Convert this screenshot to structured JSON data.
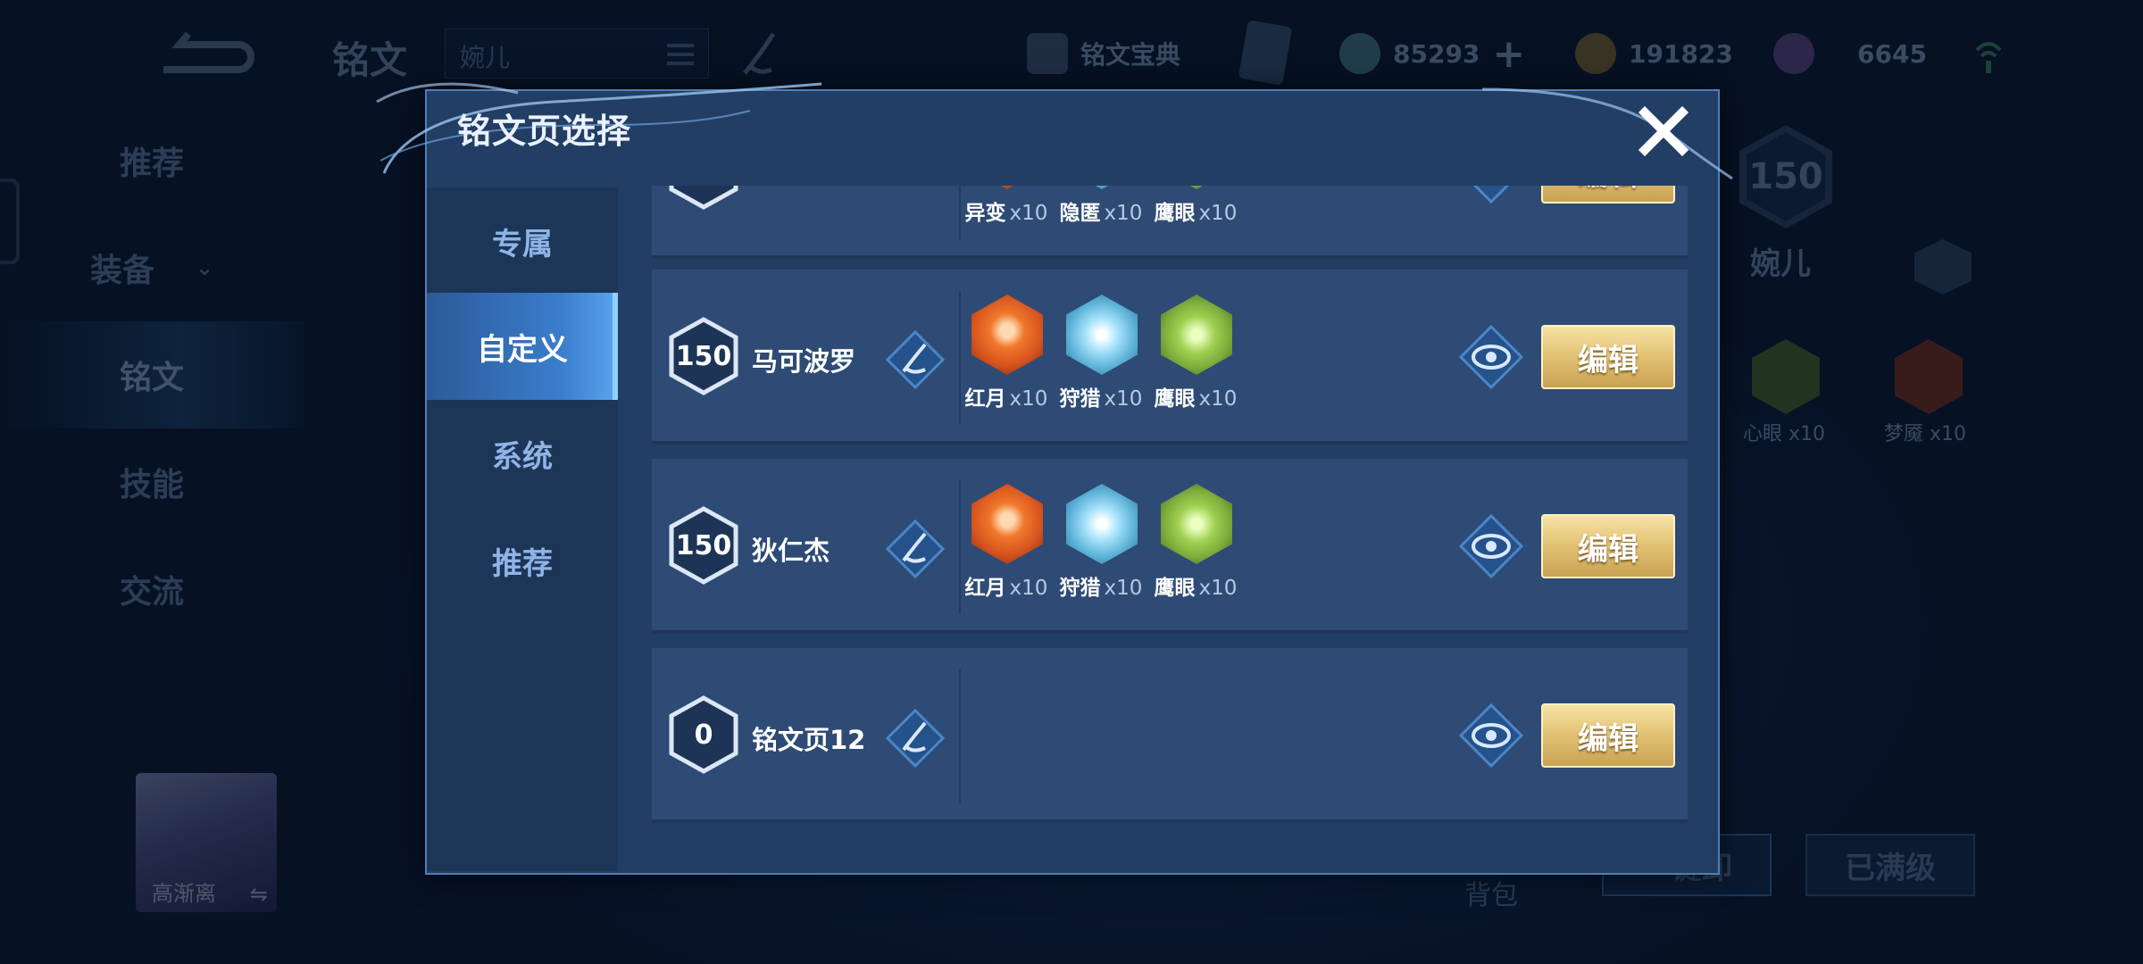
{
  "page": {
    "title": "铭文",
    "hero_search_value": "婉儿",
    "codex_label": "铭文宝典",
    "currencies": {
      "coupons": "85293",
      "gold": "191823",
      "crystal": "6645"
    },
    "nav": [
      "推荐",
      "装备",
      "铭文",
      "技能",
      "交流"
    ],
    "hero_name": "高渐离",
    "right_hero_name": "婉儿",
    "right_level": "150",
    "right_runes": [
      "心眼 x10",
      "梦魇 x10"
    ],
    "bag_label": "背包",
    "unload_label": "一键卸",
    "maxed_label": "已满级"
  },
  "modal": {
    "title": "铭文页选择",
    "tabs": [
      {
        "label": "专属"
      },
      {
        "label": "自定义"
      },
      {
        "label": "系统"
      },
      {
        "label": "推荐"
      }
    ],
    "active_tab": "自定义",
    "pages": [
      {
        "level": "",
        "name": "",
        "runes": [
          {
            "name": "异变",
            "count": "x10",
            "color": "#c9572a"
          },
          {
            "name": "隐匿",
            "count": "x10",
            "color": "#5fb4d9"
          },
          {
            "name": "鹰眼",
            "count": "x10",
            "color": "#7fae3d"
          }
        ],
        "edit": "编辑"
      },
      {
        "level": "150",
        "name": "马可波罗",
        "runes": [
          {
            "name": "红月",
            "count": "x10",
            "color": "#d8541e"
          },
          {
            "name": "狩猎",
            "count": "x10",
            "color": "#5fb4d9"
          },
          {
            "name": "鹰眼",
            "count": "x10",
            "color": "#7fae3d"
          }
        ],
        "edit": "编辑"
      },
      {
        "level": "150",
        "name": "狄仁杰",
        "runes": [
          {
            "name": "红月",
            "count": "x10",
            "color": "#d8541e"
          },
          {
            "name": "狩猎",
            "count": "x10",
            "color": "#5fb4d9"
          },
          {
            "name": "鹰眼",
            "count": "x10",
            "color": "#7fae3d"
          }
        ],
        "edit": "编辑"
      },
      {
        "level": "0",
        "name": "铭文页12",
        "runes": [],
        "edit": "编辑"
      }
    ]
  },
  "colors": {
    "accent": "#3b7dcc",
    "gold_button": "#e4c477",
    "panel": "#233e65",
    "card": "#2e4b75"
  }
}
